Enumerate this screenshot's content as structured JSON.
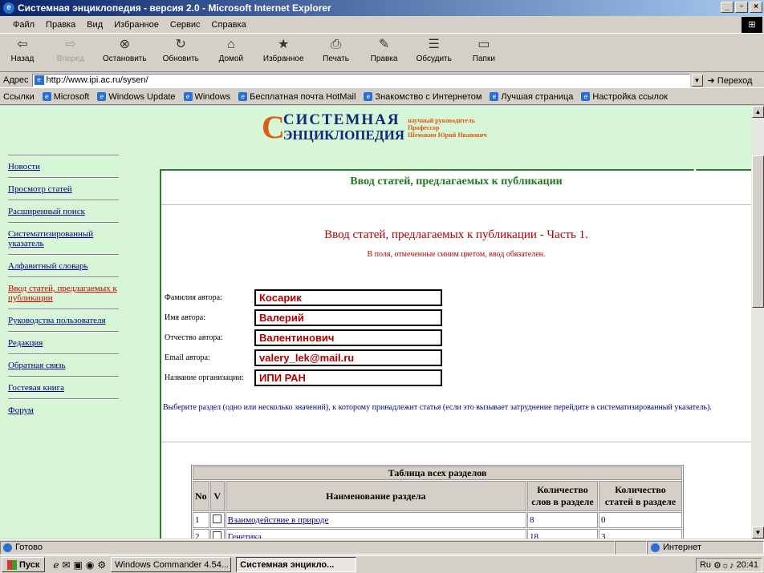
{
  "window": {
    "title": "Системная энциклопедия - версия 2.0 - Microsoft Internet Explorer"
  },
  "menu": [
    "Файл",
    "Правка",
    "Вид",
    "Избранное",
    "Сервис",
    "Справка"
  ],
  "toolbar": [
    {
      "label": "Назад",
      "icon": "back-arrow"
    },
    {
      "label": "Вперед",
      "icon": "forward-arrow"
    },
    {
      "label": "Остановить",
      "icon": "stop"
    },
    {
      "label": "Обновить",
      "icon": "refresh"
    },
    {
      "label": "Домой",
      "icon": "home"
    },
    {
      "label": "Избранное",
      "icon": "favorites"
    },
    {
      "label": "Печать",
      "icon": "print"
    },
    {
      "label": "Правка",
      "icon": "edit"
    },
    {
      "label": "Обсудить",
      "icon": "discuss"
    },
    {
      "label": "Папки",
      "icon": "folders"
    }
  ],
  "address": {
    "label": "Адрес",
    "url": "http://www.ipi.ac.ru/sysen/",
    "go": "Переход"
  },
  "links": {
    "label": "Ссылки",
    "items": [
      "Microsoft",
      "Windows Update",
      "Windows",
      "Бесплатная почта HotMail",
      "Знакомство с Интернетом",
      "Лучшая страница",
      "Настройка ссылок"
    ]
  },
  "logo": {
    "line1": "СИСТЕМНАЯ",
    "line2": "ЭНЦИКЛОПЕДИЯ",
    "side1": "научный руководитель",
    "side2": "Профессор",
    "side3": "Шемакин Юрий Иванович"
  },
  "nav": [
    {
      "label": "Новости"
    },
    {
      "label": "Просмотр статей"
    },
    {
      "label": "Расширенный поиск"
    },
    {
      "label": "Систематизированный указатель"
    },
    {
      "label": "Алфавитный словарь"
    },
    {
      "label": "Ввод статей, предлагаемых к публикации",
      "active": true
    },
    {
      "label": "Руководства пользователя"
    },
    {
      "label": "Редакция"
    },
    {
      "label": "Обратная связь"
    },
    {
      "label": "Гостевая книга"
    },
    {
      "label": "Форум"
    }
  ],
  "content": {
    "header": "Ввод статей, предлагаемых к публикации",
    "part_title": "Ввод статей, предлагаемых к публикации - Часть 1.",
    "note": "В поля, отмеченные синим цветом, ввод обязателен.",
    "fields": [
      {
        "label": "Фамилия автора:",
        "value": "Косарик"
      },
      {
        "label": "Имя автора:",
        "value": "Валерий"
      },
      {
        "label": "Отчество автора:",
        "value": "Валентинович"
      },
      {
        "label": "Email автора:",
        "value": "valery_lek@mail.ru"
      },
      {
        "label": "Название организации:",
        "value": "ИПИ РАН"
      }
    ],
    "instruction": "Выберите раздел (одно или несколько значений), к которому принадлежит статья (если это вызывает затруднение перейдите в систематизированный указатель)."
  },
  "table": {
    "caption": "Таблица всех разделов",
    "columns": [
      "No",
      "V",
      "Наименование раздела",
      "Количество слов в разделе",
      "Количество статей в разделе"
    ],
    "rows": [
      {
        "no": "1",
        "name": "Взаимодействие в природе",
        "words": "8",
        "articles": "0"
      },
      {
        "no": "2",
        "name": "Генетика",
        "words": "18",
        "articles": "3"
      }
    ]
  },
  "status": {
    "text": "Готово",
    "zone": "Интернет"
  },
  "taskbar": {
    "start": "Пуск",
    "tasks": [
      "Windows Commander 4.54...",
      "Системная энцикло..."
    ],
    "clock": "20:41",
    "lang": "Ru"
  },
  "colors": {
    "page_bg": "#d7f5d7",
    "header_green": "#1f7a1f",
    "accent_red": "#b00000",
    "link_blue": "#000080"
  }
}
